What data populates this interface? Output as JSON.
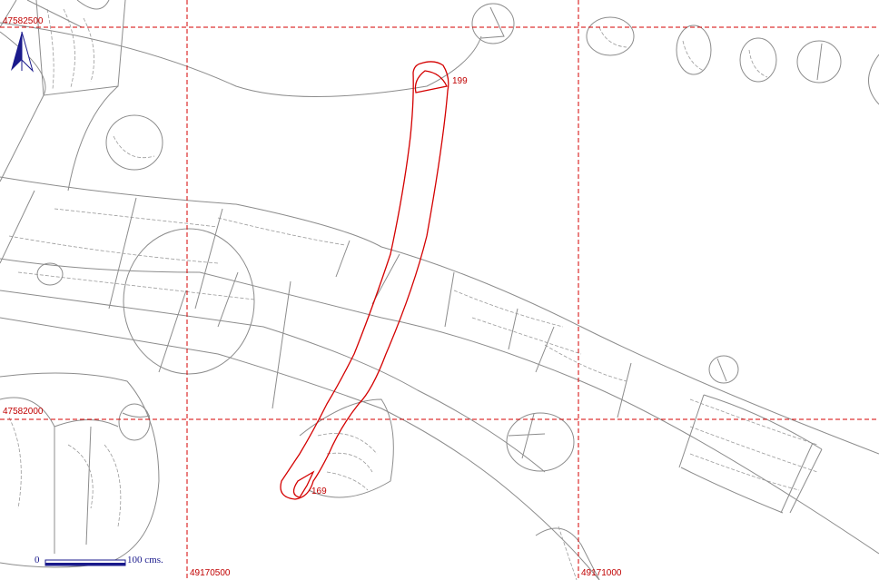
{
  "grid": {
    "northing_top": "47582500",
    "northing_mid": "47582000",
    "easting_left": "49170500",
    "easting_right": "49171000"
  },
  "highlight": {
    "label_start": "199",
    "label_end": "169"
  },
  "scale": {
    "zero_label": "0",
    "length_label": "100 cms."
  },
  "colors": {
    "grid": "#d40000",
    "highlight": "#d40000",
    "features": "#8c8c8c",
    "north_arrow": "#1a1a8c"
  },
  "icons": {
    "north_arrow": "north-arrow-icon"
  }
}
